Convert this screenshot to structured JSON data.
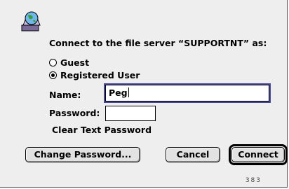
{
  "dialog": {
    "prompt": "Connect to the file server “SUPPORTNT” as:",
    "icon": "appleshare-globe-icon"
  },
  "login_type": {
    "guest_label": "Guest",
    "registered_label": "Registered User",
    "selected": "Registered User"
  },
  "fields": {
    "name_label": "Name:",
    "name_value": "Peg",
    "password_label": "Password:",
    "password_value": "",
    "security_note": "Clear Text Password"
  },
  "buttons": {
    "change_password": "Change Password...",
    "cancel": "Cancel",
    "connect": "Connect"
  },
  "footer": {
    "build_number": "383"
  }
}
